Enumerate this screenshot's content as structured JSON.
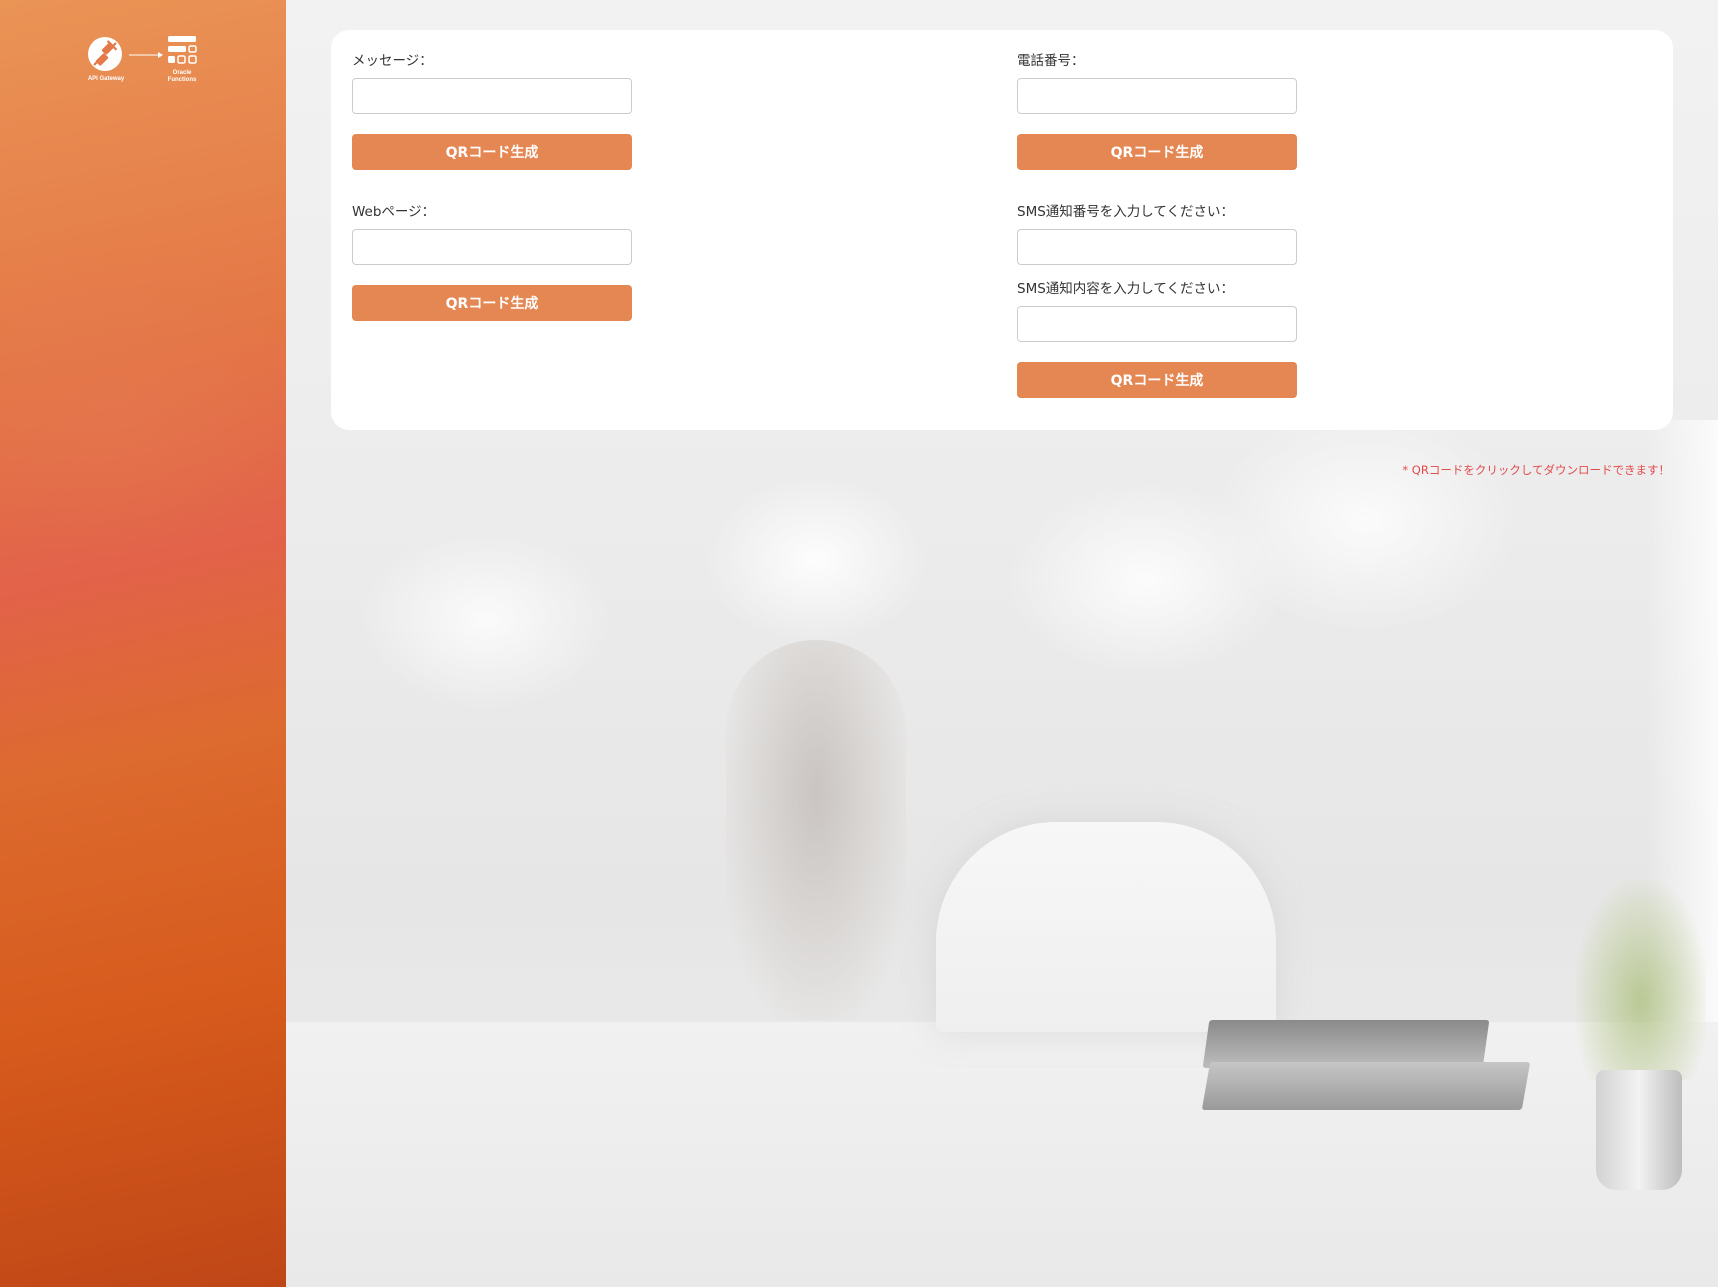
{
  "sidebar": {
    "logo": {
      "left_label": "API Gateway",
      "right_label_line1": "Oracle",
      "right_label_line2": "Functions",
      "left_icon": "api-gateway-icon",
      "right_icon": "oracle-functions-icon",
      "arrow_icon": "arrow-right-icon"
    }
  },
  "form": {
    "message": {
      "label": "メッセージ：",
      "value": "",
      "button": "QRコード生成"
    },
    "phone": {
      "label": "電話番号：",
      "value": "",
      "button": "QRコード生成"
    },
    "web": {
      "label": "Webページ：",
      "value": "",
      "button": "QRコード生成"
    },
    "sms": {
      "number_label": "SMS通知番号を入力してください：",
      "number_value": "",
      "content_label": "SMS通知内容を入力してください：",
      "content_value": "",
      "button": "QRコード生成"
    }
  },
  "note": "* QRコードをクリックしてダウンロードできます！",
  "colors": {
    "accent": "#e58752",
    "note": "#e34a4a",
    "sidebar_top": "#ea9456",
    "sidebar_bottom": "#bf4617"
  }
}
